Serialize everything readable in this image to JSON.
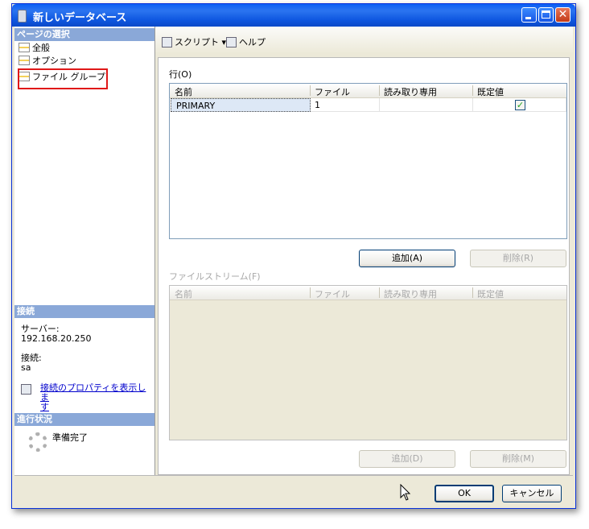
{
  "window": {
    "title": "新しいデータベース"
  },
  "left": {
    "page_select_header": "ページの選択",
    "nav_items": [
      {
        "label": "全般"
      },
      {
        "label": "オプション"
      },
      {
        "label": "ファイル グループ"
      }
    ],
    "connection_header": "接続",
    "server_label": "サーバー:",
    "server_value": "192.168.20.250",
    "connection_label": "接続:",
    "connection_value": "sa",
    "connection_link_line1": "接続のプロパティを表示しま",
    "connection_link_line2": "す",
    "progress_header": "進行状況",
    "progress_status": "準備完了"
  },
  "toolbar": {
    "script_label": "スクリプト",
    "help_label": "ヘルプ"
  },
  "rows": {
    "label": "行(O)",
    "columns": [
      "名前",
      "ファイル",
      "読み取り専用",
      "既定値"
    ],
    "data": [
      {
        "name": "PRIMARY",
        "files": "1",
        "readonly": false,
        "default": true
      }
    ],
    "add_button": "追加(A)",
    "delete_button": "削除(R)"
  },
  "filestream": {
    "label": "ファイルストリーム(F)",
    "columns": [
      "名前",
      "ファイル",
      "読み取り専用",
      "既定値"
    ],
    "add_button": "追加(D)",
    "delete_button": "削除(M)"
  },
  "dialog": {
    "ok": "OK",
    "cancel": "キャンセル"
  }
}
